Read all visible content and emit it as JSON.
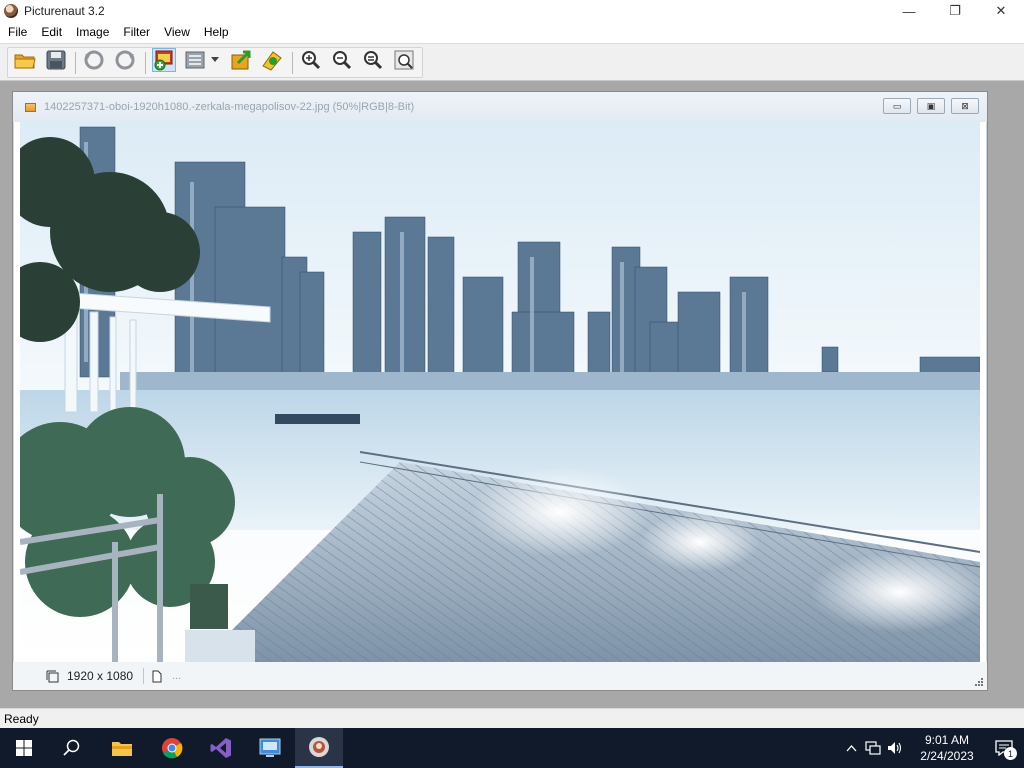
{
  "window": {
    "title": "Picturenaut 3.2",
    "minimize_glyph": "—",
    "restore_glyph": "❐",
    "close_glyph": "✕"
  },
  "menu": [
    "File",
    "Edit",
    "Image",
    "Filter",
    "View",
    "Help"
  ],
  "toolbar": {
    "buttons": [
      "open-folder-icon",
      "save-icon",
      "undo-icon",
      "redo-icon",
      "create-hdr-icon",
      "batch-list-icon",
      "export-icon",
      "tonemap-icon",
      "zoom-in-icon",
      "zoom-out-icon",
      "zoom-fit-icon",
      "zoom-actual-icon"
    ]
  },
  "document": {
    "title": "1402257371-oboi-1920h1080.-zerkala-megapolisov-22.jpg (50%|RGB|8-Bit)",
    "minimize_glyph": "▭",
    "maximize_glyph": "▣",
    "close_glyph": "⊠",
    "image_size": "1920 x 1080",
    "more": "..."
  },
  "status": {
    "text": "Ready"
  },
  "taskbar": {
    "time": "9:01 AM",
    "date": "2/24/2023",
    "notification_count": "1",
    "apps": [
      "start-icon",
      "search-icon",
      "file-explorer-icon",
      "chrome-icon",
      "visual-studio-icon",
      "control-panel-icon",
      "picturenaut-icon"
    ]
  },
  "colors": {
    "taskbar": "#101a2b",
    "accent": "#0078d7",
    "workspace": "#a8a8a8"
  }
}
